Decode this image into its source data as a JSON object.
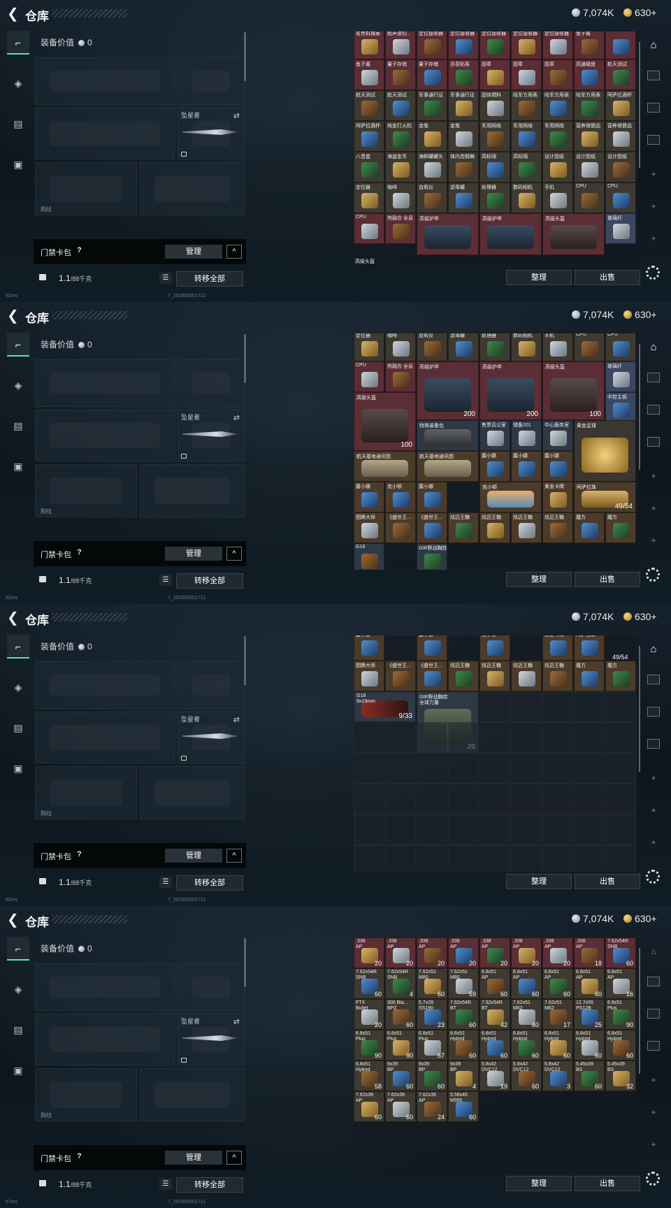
{
  "header": {
    "title": "仓库",
    "silver": "7,074K",
    "gold": "630+"
  },
  "left": {
    "equipment_value_label": "装备价值",
    "equipment_value": "0",
    "knife_name": "坠星者",
    "sub_label": "胸挂",
    "key_label": "门禁卡包",
    "key_help": "?",
    "manage_label": "管理",
    "collapse_icon": "^",
    "weight": "1.1",
    "weight_unit": "/88千克",
    "transfer_label": "转移全部"
  },
  "grid_buttons": {
    "sort": "整理",
    "sell": "出售"
  },
  "status": {
    "ping_1": "82ms",
    "ping_2": "82ms",
    "ping_3": "82ms",
    "ping_4": "87ms",
    "build": "7_202608301711"
  },
  "screen1": [
    [
      "名贵机械表",
      "超声波切...",
      "定位接收器",
      "定位接收器",
      "定位接收器",
      "定位接收器",
      "定位接收器",
      "鱼子酱",
      ""
    ],
    [
      "鱼子酱",
      "量子存储",
      "量子存储",
      "亦吾贴客",
      "勋章",
      "勋章",
      "勋章",
      "高速磁盘",
      "航天测试"
    ],
    [
      "航天测试",
      "航天测试",
      "军事通行证",
      "军事通行证",
      "固体燃料",
      "陆军方用表",
      "陆军方用表",
      "陆军方用表",
      "阿萨拉酒杯"
    ],
    [
      "阿萨拉酒杯",
      "纯金打火机",
      "金笔",
      "金笔",
      "军用网络",
      "军用网络",
      "军用网络",
      "营养保健品",
      "营养保健品"
    ],
    [
      "八音盒",
      "海盗金币",
      "海鲜罐罐头",
      "体内苦醇酶",
      "高标隔",
      "高标隔",
      "设计图纸",
      "设计图纸",
      "设计图纸"
    ],
    [
      "定位器",
      "咖啡",
      "血氧仪",
      "滤毒罐",
      "处理器",
      "数码相机",
      "手机",
      "CPU",
      "CPU"
    ]
  ],
  "screen1_bottom": {
    "cpu": "CPU",
    "fusion": "热融合 全息",
    "armor1": "高级护甲",
    "armor2": "高级护甲",
    "helmet": "高级头盔",
    "fiber": "玻璃纤",
    "helmet2": "高级头盔"
  },
  "screen2_top": [
    "定位器",
    "咖啡",
    "血氧仪",
    "滤毒罐",
    "处理器",
    "数码相机",
    "手机",
    "CPU",
    "CPU"
  ],
  "screen2": {
    "cpu": "CPU",
    "fusion": "热融合 全息",
    "armor": "高级护甲",
    "helmet": "高级头盔",
    "fiber": "玻璃纤",
    "cap": "中控主板",
    "dur1": "200",
    "dur2": "200",
    "dur3": "100",
    "dur4": "100",
    "special_box": "特殊装备包",
    "tickets": [
      "售票员公室",
      "储备201",
      "中心服务室"
    ],
    "gold_ball": "黄金足球",
    "maps": [
      "航天基地通讯图",
      "航天基地通讯图"
    ],
    "figures": [
      "露小娜",
      "露小娜",
      "露小娜",
      "露小娜",
      "克小顿",
      "露小娜"
    ],
    "gold_card": "黄金卡牌",
    "relic": "阿萨拉珠",
    "relic_count": "49/54",
    "row6": [
      "图腾大师",
      "《盛世王...",
      "《盛世王...",
      "炫迈王糖",
      "炫迈王糖",
      "炫迈王糖",
      "炫迈王糖",
      "魔方",
      "魔方"
    ],
    "row7": [
      "G18",
      "GIR野战胸挂"
    ]
  },
  "screen3": {
    "top_row": [
      "露小娜",
      "露小娜",
      "克小顿",
      "",
      "黄金卡牌",
      "阿萨拉珠"
    ],
    "relic_count": "49/54",
    "row2": [
      "图腾大师",
      "《盛世王...",
      "《盛世王...",
      "炫迈王糖",
      "炫迈王糖",
      "炫迈王糖",
      "炫迈王糖",
      "魔方",
      "魔方"
    ],
    "g18_name": "G18",
    "g18_ammo": "9x19mm",
    "g18_count": "9/33",
    "vest_name": "GIR野战胸挂",
    "vest_sub": "全球力量",
    "vest_count": "20"
  },
  "screen4": [
    [
      [
        ".338",
        "AP",
        "20"
      ],
      [
        ".338",
        "AP",
        "20"
      ],
      [
        ".338",
        "AP",
        "20"
      ],
      [
        ".338",
        "AP",
        "20"
      ],
      [
        ".338",
        "AP",
        "20"
      ],
      [
        ".338",
        "AP",
        "20"
      ],
      [
        ".338",
        "AP",
        "20"
      ],
      [
        ".338",
        "AP",
        "18"
      ],
      [
        "7.62x54R",
        "SNB",
        "60"
      ]
    ],
    [
      [
        "7.62x54R",
        "SNB",
        "60"
      ],
      [
        "7.62x54R",
        "SNB",
        "4"
      ],
      [
        "7.62x51",
        "M80",
        "60"
      ],
      [
        "7.62x51",
        "M80",
        "59"
      ],
      [
        "6.8x51",
        "AP",
        "60"
      ],
      [
        "6.8x51",
        "AP",
        "60"
      ],
      [
        "6.8x51",
        "AP",
        "60"
      ],
      [
        "6.8x51",
        "AP",
        "60"
      ],
      [
        "6.8x51",
        "AP",
        "16"
      ]
    ],
    [
      [
        "FTX",
        "Bullet",
        "20"
      ],
      [
        "300 Bla...",
        "BPZ",
        "60"
      ],
      [
        "5.7x28",
        "SS190",
        "23"
      ],
      [
        "7.62x54R",
        "BT",
        "60"
      ],
      [
        "7.62x54R",
        "BT",
        "42"
      ],
      [
        "7.62x51",
        "M62",
        "60"
      ],
      [
        "7.62x51",
        "M62",
        "17"
      ],
      [
        "12.7x55",
        "PS12B",
        "25"
      ],
      [
        "6.8x51",
        "Plus",
        "90"
      ]
    ],
    [
      [
        "6.8x51",
        "Plus",
        "90"
      ],
      [
        "6.8x51",
        "Plus",
        "90"
      ],
      [
        "6.8x51",
        "Plus",
        "67"
      ],
      [
        "8.6x51",
        "Hybrid",
        "60"
      ],
      [
        "6.8x51",
        "Hybrid",
        "60"
      ],
      [
        "6.8x51",
        "Hybrid",
        "60"
      ],
      [
        "6.8x51",
        "Hybrid",
        "60"
      ],
      [
        "6.8x51",
        "Hybrid",
        "60"
      ],
      [
        "6.8x51",
        "Hybrid",
        "60"
      ]
    ],
    [
      [
        "6.8x51",
        "Hybrid",
        "58"
      ],
      [
        "9x39",
        "BP",
        "60"
      ],
      [
        "9x39",
        "BP",
        "60"
      ],
      [
        "9x39",
        "BP",
        "4"
      ],
      [
        "5.8x42",
        "DVC12",
        "19"
      ],
      [
        "5.8x42",
        "DVC12",
        "60"
      ],
      [
        "5.8x42",
        "DVC12",
        "3"
      ],
      [
        "5.45x39",
        "BS",
        "60"
      ],
      [
        "5.45x39",
        "BS",
        "32"
      ]
    ],
    [
      [
        "7.62x39",
        "AP",
        "60"
      ],
      [
        "7.62x39",
        "AP",
        "60"
      ],
      [
        "7.62x39",
        "AP",
        "24"
      ],
      [
        "5.56x45",
        "M995",
        "60"
      ]
    ]
  ],
  "rail": {
    "plus": "+",
    "plus2": "+",
    "plus3": "+",
    "plus4": "+",
    "plus5": "+"
  }
}
